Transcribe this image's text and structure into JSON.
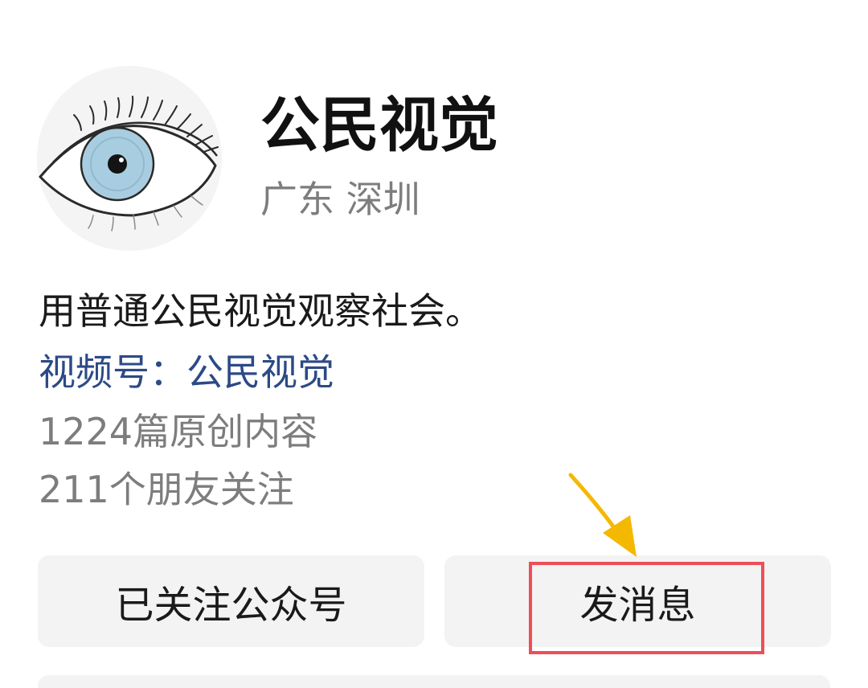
{
  "profile": {
    "name": "公民视觉",
    "location": "广东 深圳",
    "bio": "用普通公民视觉观察社会。",
    "channels_label": "视频号：公民视觉",
    "articles": "1224篇原创内容",
    "followers": "211个朋友关注"
  },
  "actions": {
    "follow_label": "已关注公众号",
    "message_label": "发消息"
  },
  "annotations": {
    "highlight_color": "#ee4e57",
    "arrow_color": "#f5b800",
    "link_color": "#2c4a86"
  }
}
